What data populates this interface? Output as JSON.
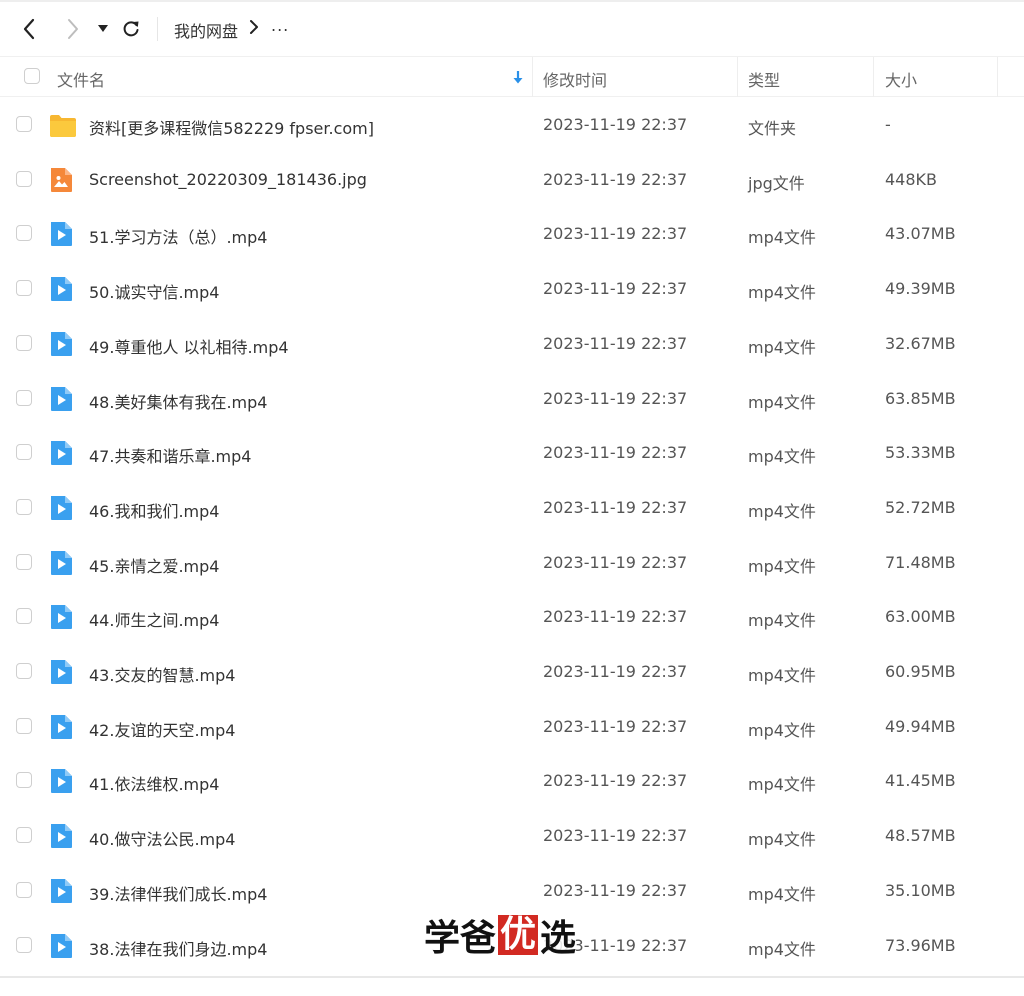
{
  "nav": {
    "breadcrumb_root": "我的网盘",
    "breadcrumb_more": "..."
  },
  "table": {
    "columns": {
      "name": "文件名",
      "modified": "修改时间",
      "type": "类型",
      "size": "大小"
    },
    "rows": [
      {
        "name": "资料[更多课程微信582229 fpser.com]",
        "modified": "2023-11-19 22:37",
        "type": "文件夹",
        "size": "-",
        "icon": "folder-icon"
      },
      {
        "name": "Screenshot_20220309_181436.jpg",
        "modified": "2023-11-19 22:37",
        "type": "jpg文件",
        "size": "448KB",
        "icon": "image-file-icon"
      },
      {
        "name": "51.学习方法（总）.mp4",
        "modified": "2023-11-19 22:37",
        "type": "mp4文件",
        "size": "43.07MB",
        "icon": "video-file-icon"
      },
      {
        "name": "50.诚实守信.mp4",
        "modified": "2023-11-19 22:37",
        "type": "mp4文件",
        "size": "49.39MB",
        "icon": "video-file-icon"
      },
      {
        "name": "49.尊重他人 以礼相待.mp4",
        "modified": "2023-11-19 22:37",
        "type": "mp4文件",
        "size": "32.67MB",
        "icon": "video-file-icon"
      },
      {
        "name": "48.美好集体有我在.mp4",
        "modified": "2023-11-19 22:37",
        "type": "mp4文件",
        "size": "63.85MB",
        "icon": "video-file-icon"
      },
      {
        "name": "47.共奏和谐乐章.mp4",
        "modified": "2023-11-19 22:37",
        "type": "mp4文件",
        "size": "53.33MB",
        "icon": "video-file-icon"
      },
      {
        "name": "46.我和我们.mp4",
        "modified": "2023-11-19 22:37",
        "type": "mp4文件",
        "size": "52.72MB",
        "icon": "video-file-icon"
      },
      {
        "name": "45.亲情之爱.mp4",
        "modified": "2023-11-19 22:37",
        "type": "mp4文件",
        "size": "71.48MB",
        "icon": "video-file-icon"
      },
      {
        "name": "44.师生之间.mp4",
        "modified": "2023-11-19 22:37",
        "type": "mp4文件",
        "size": "63.00MB",
        "icon": "video-file-icon"
      },
      {
        "name": "43.交友的智慧.mp4",
        "modified": "2023-11-19 22:37",
        "type": "mp4文件",
        "size": "60.95MB",
        "icon": "video-file-icon"
      },
      {
        "name": "42.友谊的天空.mp4",
        "modified": "2023-11-19 22:37",
        "type": "mp4文件",
        "size": "49.94MB",
        "icon": "video-file-icon"
      },
      {
        "name": "41.依法维权.mp4",
        "modified": "2023-11-19 22:37",
        "type": "mp4文件",
        "size": "41.45MB",
        "icon": "video-file-icon"
      },
      {
        "name": "40.做守法公民.mp4",
        "modified": "2023-11-19 22:37",
        "type": "mp4文件",
        "size": "48.57MB",
        "icon": "video-file-icon"
      },
      {
        "name": "39.法律伴我们成长.mp4",
        "modified": "2023-11-19 22:37",
        "type": "mp4文件",
        "size": "35.10MB",
        "icon": "video-file-icon"
      },
      {
        "name": "38.法律在我们身边.mp4",
        "modified": "2023-11-19 22:37",
        "type": "mp4文件",
        "size": "73.96MB",
        "icon": "video-file-icon"
      }
    ]
  },
  "watermark": {
    "part1": "学爸",
    "seal": "优",
    "part2": "选"
  },
  "colors": {
    "folder": "#f7b731",
    "video": "#3aa0ef",
    "image": "#f5883a",
    "sort_arrow": "#2a90e8",
    "watermark_seal": "#d22a22"
  }
}
